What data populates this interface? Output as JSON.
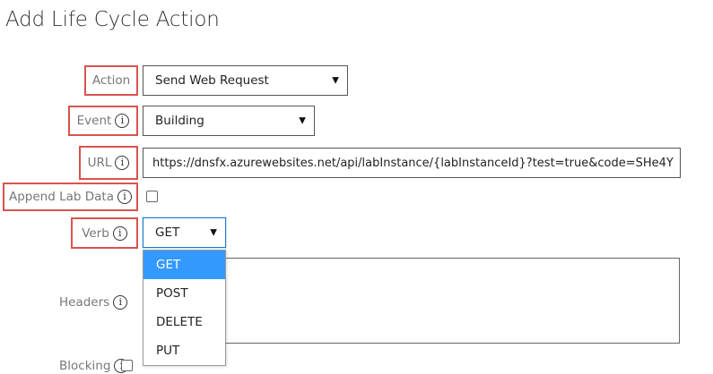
{
  "page": {
    "title": "Add Life Cycle Action"
  },
  "form": {
    "action": {
      "label": "Action",
      "value": "Send Web Request"
    },
    "event": {
      "label": "Event",
      "value": "Building"
    },
    "url": {
      "label": "URL",
      "value": "https://dnsfx.azurewebsites.net/api/labInstance/{labInstanceId}?test=true&code=SHe4Y"
    },
    "append_lab_data": {
      "label": "Append Lab Data",
      "checked": false
    },
    "verb": {
      "label": "Verb",
      "value": "GET",
      "options": [
        "GET",
        "POST",
        "DELETE",
        "PUT"
      ],
      "selected_index": 0
    },
    "headers": {
      "label": "Headers"
    },
    "blocking": {
      "label": "Blocking"
    }
  },
  "icons": {
    "info": "info-circle-icon",
    "caret": "caret-down-icon"
  },
  "colors": {
    "highlight": "#d9534f",
    "focus": "#1e78c8",
    "selected_option": "#3399ff"
  }
}
